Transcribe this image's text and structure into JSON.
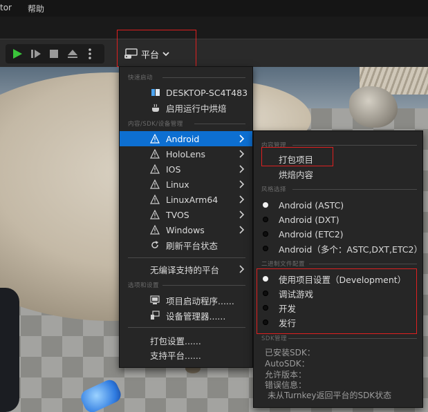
{
  "menubar": {
    "items": [
      "tor",
      "帮助"
    ]
  },
  "toolbar": {
    "play_icon": "play-icon",
    "platform_label": "平台"
  },
  "platform_menu": {
    "section_quick": "快速启动",
    "desktop": "DESKTOP-SC4T483",
    "cook_running": "启用运行中烘焙",
    "section_content": "内容/SDK/设备管理",
    "platforms": [
      "Android",
      "HoloLens",
      "IOS",
      "Linux",
      "LinuxArm64",
      "TVOS",
      "Windows"
    ],
    "refresh": "刷新平台状态",
    "unsupported": "无编译支持的平台",
    "section_options": "选项和设置",
    "launcher": "项目启动程序......",
    "device_manager": "设备管理器......",
    "package_settings": "打包设置......",
    "supported_platforms": "支持平台......"
  },
  "android_menu": {
    "section_content": "内容管理",
    "package_project": "打包项目",
    "cook_content": "烘焙内容",
    "section_flavor": "风格选择",
    "flavors": [
      {
        "label": "Android (ASTC)",
        "selected": true
      },
      {
        "label": "Android (DXT)",
        "selected": false
      },
      {
        "label": "Android (ETC2)",
        "selected": false
      },
      {
        "label": "Android（多个：ASTC,DXT,ETC2）",
        "selected": false
      }
    ],
    "section_binary": "二进制文件配置",
    "configs": [
      {
        "label": "使用项目设置（Development）",
        "selected": true
      },
      {
        "label": "调试游戏",
        "selected": false
      },
      {
        "label": "开发",
        "selected": false
      },
      {
        "label": "发行",
        "selected": false
      }
    ],
    "section_sdk": "SDK管理",
    "sdk_lines": [
      "已安装SDK：",
      "AutoSDK：",
      "允许版本：",
      "错误信息：",
      "未从Turnkey返回平台的SDK状态"
    ]
  },
  "colors": {
    "highlight": "#0d6fd1",
    "annotation": "#e02020",
    "play_green": "#3ac43a"
  }
}
